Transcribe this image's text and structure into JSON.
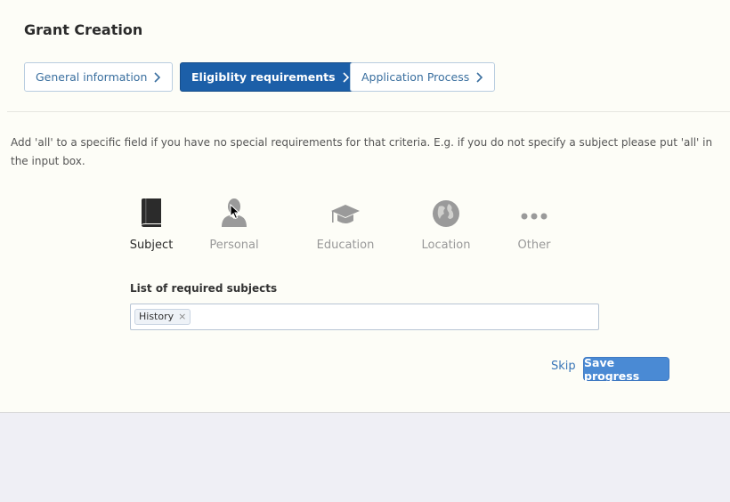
{
  "page": {
    "title": "Grant Creation"
  },
  "steps": [
    {
      "label": "General information",
      "state": "inactive"
    },
    {
      "label": "Eligiblity requirements",
      "state": "active"
    },
    {
      "label": "Application Process",
      "state": "inactive"
    }
  ],
  "info_text": "Add 'all' to a specific field if you have no special requirements for that criteria. E.g. if you do not specify a subject please put 'all' in the input box.",
  "categories": [
    {
      "label": "Subject",
      "icon": "book-icon",
      "active": true
    },
    {
      "label": "Personal",
      "icon": "person-icon",
      "active": false
    },
    {
      "label": "Education",
      "icon": "graduation-cap-icon",
      "active": false
    },
    {
      "label": "Location",
      "icon": "globe-icon",
      "active": false
    },
    {
      "label": "Other",
      "icon": "ellipsis-icon",
      "active": false
    }
  ],
  "subjects_field": {
    "label": "List of required subjects",
    "tags": [
      "History"
    ],
    "remove_symbol": "×"
  },
  "actions": {
    "skip_label": "Skip",
    "save_label": "Save progress"
  },
  "colors": {
    "primary": "#1c5fa8",
    "save_button": "#4a8ad4",
    "link": "#3a76b8",
    "card_bg": "#fdfdf7",
    "page_bg": "#efeff5"
  }
}
